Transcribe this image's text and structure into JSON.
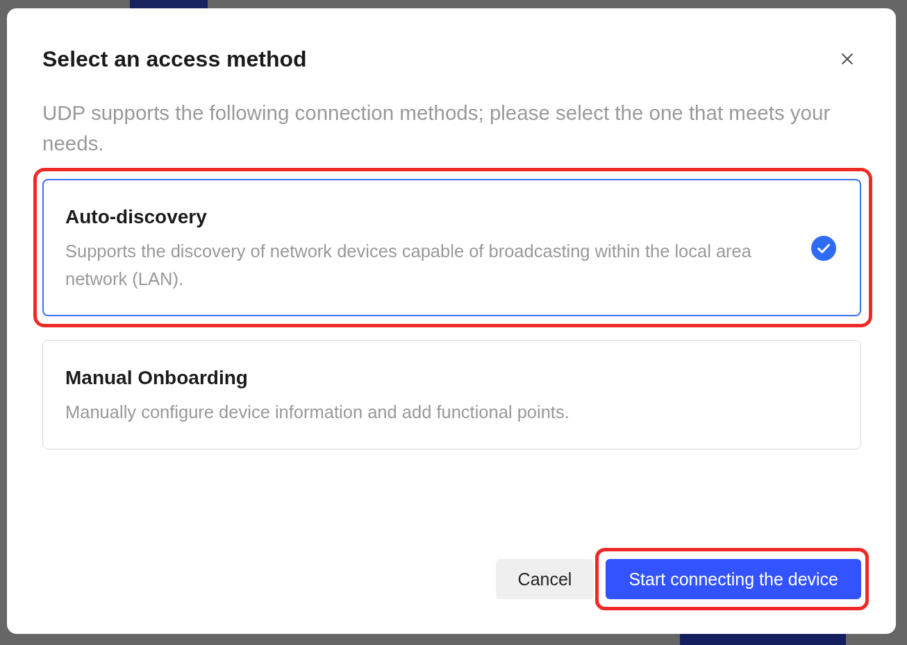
{
  "dialog": {
    "title": "Select an access method",
    "description": "UDP supports the following connection methods; please select the one that meets your needs.",
    "options": [
      {
        "title": "Auto-discovery",
        "description": "Supports the discovery of network devices capable of broadcasting within the local area network (LAN).",
        "selected": true,
        "highlighted": true
      },
      {
        "title": "Manual Onboarding",
        "description": "Manually configure device information and add functional points.",
        "selected": false,
        "highlighted": false
      }
    ],
    "buttons": [
      {
        "label": "Cancel",
        "kind": "secondary",
        "highlighted": false
      },
      {
        "label": "Start connecting the device",
        "kind": "primary",
        "highlighted": true
      }
    ]
  }
}
